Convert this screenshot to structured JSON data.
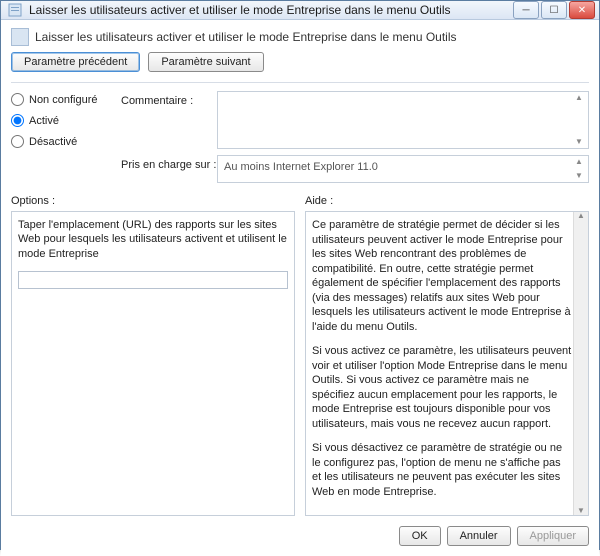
{
  "window": {
    "title": "Laisser les utilisateurs activer et utiliser le mode Entreprise dans le menu Outils",
    "minimize_glyph": "─",
    "maximize_glyph": "☐",
    "close_glyph": "✕"
  },
  "header": {
    "text": "Laisser les utilisateurs activer et utiliser le mode Entreprise dans le menu Outils"
  },
  "nav": {
    "prev": "Paramètre précédent",
    "next": "Paramètre suivant"
  },
  "state": {
    "not_configured": "Non configuré",
    "enabled": "Activé",
    "disabled": "Désactivé",
    "selected": "enabled"
  },
  "labels": {
    "comment": "Commentaire :",
    "supported": "Pris en charge sur :",
    "options": "Options :",
    "help": "Aide :"
  },
  "supported_on": "Au moins Internet Explorer 11.0",
  "options_text": "Taper l'emplacement (URL) des rapports sur les sites Web pour lesquels les utilisateurs activent et utilisent le mode Entreprise",
  "options_value": "",
  "help": {
    "p1": "Ce paramètre de stratégie permet de décider si les utilisateurs peuvent activer le mode Entreprise pour les sites Web rencontrant des problèmes de compatibilité. En outre, cette stratégie permet également de spécifier l'emplacement des rapports (via des messages) relatifs aux sites Web pour lesquels les utilisateurs activent le mode Entreprise à l'aide du menu Outils.",
    "p2": "Si vous activez ce paramètre, les utilisateurs peuvent voir et utiliser l'option Mode Entreprise dans le menu Outils. Si vous activez ce paramètre mais ne spécifiez aucun emplacement pour les rapports, le mode Entreprise est toujours disponible pour vos utilisateurs, mais vous ne recevez aucun rapport.",
    "p3": "Si vous désactivez ce paramètre de stratégie ou ne le configurez pas, l'option de menu ne s'affiche pas et les utilisateurs ne peuvent pas exécuter les sites Web en mode Entreprise."
  },
  "buttons": {
    "ok": "OK",
    "cancel": "Annuler",
    "apply": "Appliquer"
  }
}
